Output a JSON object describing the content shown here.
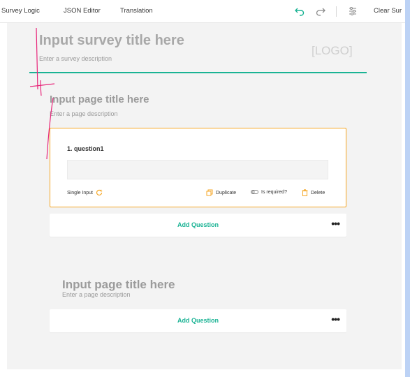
{
  "toolbar": {
    "tabs": [
      {
        "label": "Survey Logic"
      },
      {
        "label": "JSON Editor"
      },
      {
        "label": "Translation"
      }
    ],
    "undo_icon": "undo-icon",
    "redo_icon": "redo-icon",
    "settings_icon": "settings-icon",
    "clear_label": "Clear Sur"
  },
  "survey": {
    "title": "Input survey title here",
    "description": "Enter a survey description",
    "logo": "[LOGO]",
    "accent_color": "#1ab394"
  },
  "page1": {
    "title": "Input page title here",
    "description": "Enter a page description",
    "question": {
      "title": "1. question1",
      "type_label": "Single Input",
      "duplicate_label": "Duplicate",
      "required_label": "Is required?",
      "delete_label": "Delete",
      "border_color": "#f5a623"
    },
    "add_question": "Add Question",
    "more_icon": "more-dots-icon"
  },
  "page2": {
    "title": "Input page title here",
    "description": "Enter a page description",
    "add_question": "Add Question",
    "more_icon": "more-dots-icon"
  }
}
